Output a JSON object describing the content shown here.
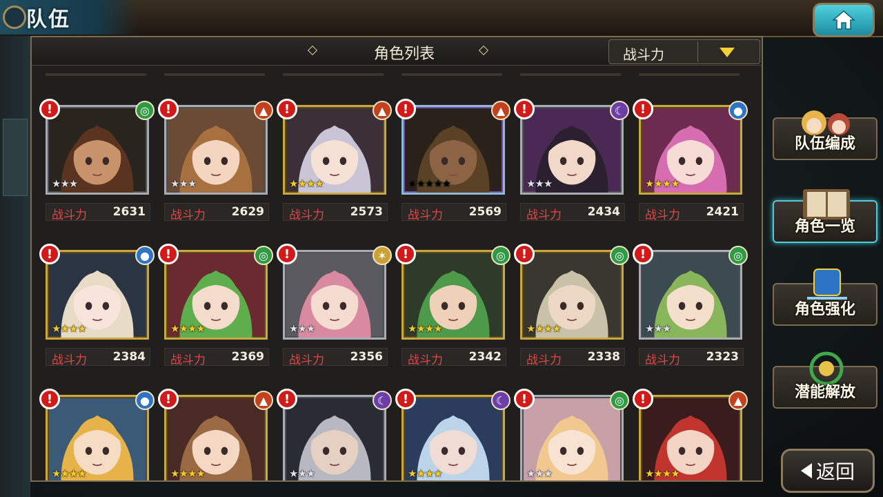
{
  "screen": {
    "title": "队伍",
    "panel_title": "角色列表",
    "sort": {
      "label": "战斗力"
    }
  },
  "power_label": "战斗力",
  "characters": [
    {
      "power": "2631",
      "element": "wind",
      "rarity": 3,
      "frame": "silver",
      "hair": "#5a3420",
      "skin": "#c8936a",
      "bg": "#2a241f"
    },
    {
      "power": "2629",
      "element": "fire",
      "rarity": 3,
      "frame": "silver",
      "hair": "#a8703f",
      "skin": "#f4d6c0",
      "bg": "#6b4a36"
    },
    {
      "power": "2573",
      "element": "fire",
      "rarity": 4,
      "frame": "gold",
      "hair": "#c9c5d6",
      "skin": "#f6e1d6",
      "bg": "#3d2f38"
    },
    {
      "power": "2569",
      "element": "fire",
      "rarity": 5,
      "frame": "rainbow",
      "hair": "#5b4226",
      "skin": "#8d6443",
      "bg": "#2a211a"
    },
    {
      "power": "2434",
      "element": "dark",
      "rarity": 3,
      "frame": "silver",
      "hair": "#2a2030",
      "skin": "#f2d8c8",
      "bg": "#4a2a55"
    },
    {
      "power": "2421",
      "element": "water",
      "rarity": 4,
      "frame": "gold",
      "hair": "#d66db0",
      "skin": "#f7dcd6",
      "bg": "#6d2b50"
    },
    {
      "power": "2384",
      "element": "water",
      "rarity": 4,
      "frame": "gold",
      "hair": "#e8dcc8",
      "skin": "#f7e4da",
      "bg": "#2b3442"
    },
    {
      "power": "2369",
      "element": "wind",
      "rarity": 4,
      "frame": "gold",
      "hair": "#5fae4e",
      "skin": "#f4dccc",
      "bg": "#6b2a30"
    },
    {
      "power": "2356",
      "element": "light",
      "rarity": 3,
      "frame": "silver",
      "hair": "#d98aa0",
      "skin": "#f4dcd0",
      "bg": "#5a5a60"
    },
    {
      "power": "2342",
      "element": "wind",
      "rarity": 4,
      "frame": "gold",
      "hair": "#4c9a4a",
      "skin": "#efd0b8",
      "bg": "#2e3a2a"
    },
    {
      "power": "2338",
      "element": "wind",
      "rarity": 4,
      "frame": "gold",
      "hair": "#c9c2a8",
      "skin": "#ecd8c4",
      "bg": "#3a3630"
    },
    {
      "power": "2323",
      "element": "wind",
      "rarity": 3,
      "frame": "silver",
      "hair": "#89b65a",
      "skin": "#f4dfcc",
      "bg": "#3c4a52"
    },
    {
      "element": "water",
      "rarity": 4,
      "frame": "gold",
      "hair": "#e6b24a",
      "skin": "#f7dcc4",
      "bg": "#3b5a78"
    },
    {
      "element": "fire",
      "rarity": 4,
      "frame": "gold",
      "hair": "#9a6a44",
      "skin": "#f4d8c4",
      "bg": "#4a2a24"
    },
    {
      "element": "dark",
      "rarity": 3,
      "frame": "silver",
      "hair": "#b8b8c0",
      "skin": "#e6d0c2",
      "bg": "#2a2c34"
    },
    {
      "element": "dark",
      "rarity": 4,
      "frame": "gold",
      "hair": "#bcd4ea",
      "skin": "#f0dcd4",
      "bg": "#2c3c5c"
    },
    {
      "element": "wind",
      "rarity": 3,
      "frame": "silver",
      "hair": "#f0c890",
      "skin": "#f8e2d2",
      "bg": "#c8a0a8"
    },
    {
      "element": "fire",
      "rarity": 4,
      "frame": "gold",
      "hair": "#c0362e",
      "skin": "#f4d4c4",
      "bg": "#3a1c1c"
    }
  ],
  "menu": [
    {
      "label": "队伍编成",
      "active": false
    },
    {
      "label": "角色一览",
      "active": true
    },
    {
      "label": "角色强化",
      "active": false
    },
    {
      "label": "潜能解放",
      "active": false
    }
  ],
  "back_label": "返回",
  "colors": {
    "accent": "#f2d036",
    "alert": "#d11a1a",
    "power_label": "#e04848"
  }
}
